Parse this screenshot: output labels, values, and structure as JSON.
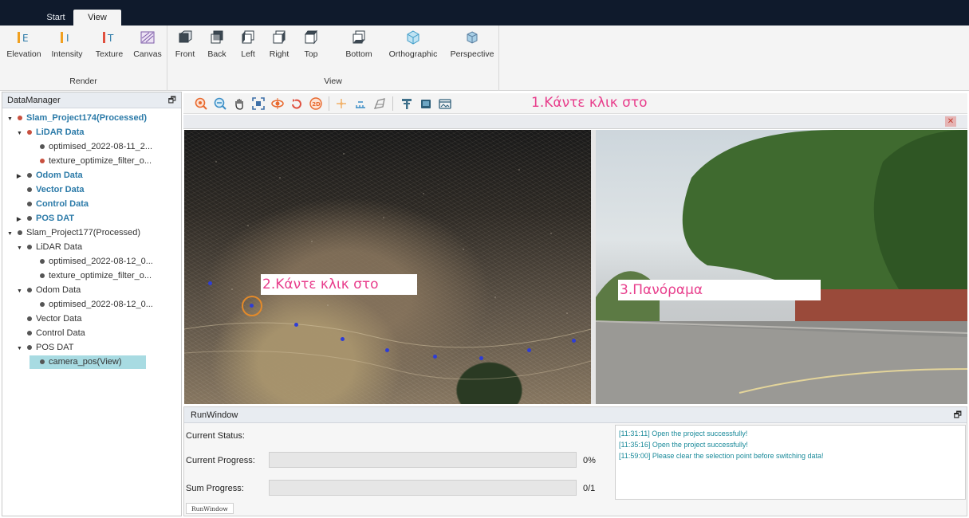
{
  "ribbon_tabs": {
    "start": "Start",
    "view": "View"
  },
  "render_group": {
    "title": "Render",
    "buttons": [
      {
        "label": "Elevation",
        "icon": "elevation-icon"
      },
      {
        "label": "Intensity",
        "icon": "intensity-icon"
      },
      {
        "label": "Texture",
        "icon": "texture-icon"
      },
      {
        "label": "Canvas",
        "icon": "canvas-icon"
      }
    ]
  },
  "view_group": {
    "title": "View",
    "buttons": [
      {
        "label": "Front",
        "icon": "cube-front-icon"
      },
      {
        "label": "Back",
        "icon": "cube-back-icon"
      },
      {
        "label": "Left",
        "icon": "cube-left-icon"
      },
      {
        "label": "Right",
        "icon": "cube-right-icon"
      },
      {
        "label": "Top",
        "icon": "cube-top-icon"
      },
      {
        "label": "Bottom",
        "icon": "cube-bottom-icon"
      },
      {
        "label": "Orthographic",
        "icon": "orthographic-icon"
      },
      {
        "label": "Perspective",
        "icon": "perspective-icon"
      }
    ]
  },
  "data_manager": {
    "title": "DataManager",
    "pin": "🗗",
    "tree": [
      {
        "label": "Slam_Project174(Processed)",
        "level": 0,
        "arrow": "▼",
        "dot": "red",
        "bold": true
      },
      {
        "label": "LiDAR Data",
        "level": 1,
        "arrow": "▼",
        "dot": "red",
        "bold": true
      },
      {
        "label": "optimised_2022-08-11_2...",
        "level": 2,
        "arrow": "",
        "dot": "grey",
        "bold": false
      },
      {
        "label": "texture_optimize_filter_o...",
        "level": 2,
        "arrow": "",
        "dot": "red",
        "bold": false
      },
      {
        "label": "Odom Data",
        "level": 1,
        "arrow": "▶",
        "dot": "grey",
        "bold": true
      },
      {
        "label": "Vector Data",
        "level": 1,
        "arrow": "",
        "dot": "grey",
        "bold": true
      },
      {
        "label": "Control Data",
        "level": 1,
        "arrow": "",
        "dot": "grey",
        "bold": true
      },
      {
        "label": "POS DAT",
        "level": 1,
        "arrow": "▶",
        "dot": "grey",
        "bold": true
      },
      {
        "label": "Slam_Project177(Processed)",
        "level": 0,
        "arrow": "▼",
        "dot": "grey",
        "bold": false
      },
      {
        "label": "LiDAR Data",
        "level": 1,
        "arrow": "▼",
        "dot": "grey",
        "bold": false
      },
      {
        "label": "optimised_2022-08-12_0...",
        "level": 2,
        "arrow": "",
        "dot": "grey",
        "bold": false
      },
      {
        "label": "texture_optimize_filter_o...",
        "level": 2,
        "arrow": "",
        "dot": "grey",
        "bold": false
      },
      {
        "label": "Odom Data",
        "level": 1,
        "arrow": "▼",
        "dot": "grey",
        "bold": false
      },
      {
        "label": "optimised_2022-08-12_0...",
        "level": 2,
        "arrow": "",
        "dot": "grey",
        "bold": false
      },
      {
        "label": "Vector Data",
        "level": 1,
        "arrow": "",
        "dot": "grey",
        "bold": false
      },
      {
        "label": "Control Data",
        "level": 1,
        "arrow": "",
        "dot": "grey",
        "bold": false
      },
      {
        "label": "POS DAT",
        "level": 1,
        "arrow": "▼",
        "dot": "grey",
        "bold": false
      },
      {
        "label": "camera_pos(View)",
        "level": 2,
        "arrow": "",
        "dot": "grey",
        "bold": false,
        "selected": true
      }
    ]
  },
  "annotations": {
    "step1": "1.Κάντε κλικ στο",
    "step2": "2.Κάντε κλικ στο",
    "step3": "3.Πανόραμα"
  },
  "viewer": {
    "close_icon": "close-icon",
    "close_glyph": "✕"
  },
  "run_window": {
    "title": "RunWindow",
    "pin": "🗗",
    "current_status_label": "Current Status:",
    "current_progress_label": "Current Progress:",
    "current_progress_value": "0%",
    "current_progress_fraction": 0,
    "sum_progress_label": "Sum Progress:",
    "sum_progress_value": "0/1",
    "sum_progress_fraction": 0,
    "log": [
      "[11:31:11] Open the project successfully!",
      "[11:35:16] Open the project successfully!",
      "[11:59:00] Please clear the selection point before switching data!"
    ],
    "tab_label": "RunWindow"
  },
  "colors": {
    "accent": "#2b7aa8",
    "annotation": "#e83e8c",
    "selection": "#a8dbe2",
    "log_text": "#1a8a9a",
    "point_marker": "#2e3dd6"
  }
}
